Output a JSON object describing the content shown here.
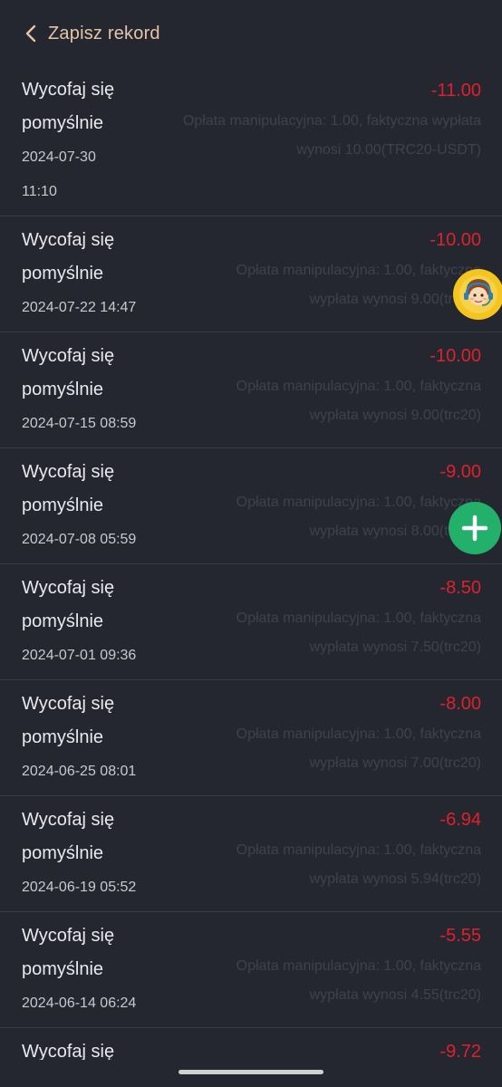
{
  "header": {
    "title": "Zapisz rekord"
  },
  "records": [
    {
      "title_line1": "Wycofaj się",
      "title_line2": "pomyślnie",
      "date": "2024-07-30",
      "time": "11:10",
      "amount": "-11.00",
      "fee_line1": "Opłata manipulacyjna: 1.00, faktyczna wypłata",
      "fee_line2": "wynosi 10.00(TRC20-USDT)"
    },
    {
      "title_line1": "Wycofaj się",
      "title_line2": "pomyślnie",
      "date": "2024-07-22 14:47",
      "amount": "-10.00",
      "fee_line1": "Opłata manipulacyjna: 1.00, faktyczna",
      "fee_line2": "wypłata wynosi 9.00(trc20)"
    },
    {
      "title_line1": "Wycofaj się",
      "title_line2": "pomyślnie",
      "date": "2024-07-15 08:59",
      "amount": "-10.00",
      "fee_line1": "Opłata manipulacyjna: 1.00, faktyczna",
      "fee_line2": "wypłata wynosi 9.00(trc20)"
    },
    {
      "title_line1": "Wycofaj się",
      "title_line2": "pomyślnie",
      "date": "2024-07-08 05:59",
      "amount": "-9.00",
      "fee_line1": "Opłata manipulacyjna: 1.00, faktyczna",
      "fee_line2": "wypłata wynosi 8.00(trc20)"
    },
    {
      "title_line1": "Wycofaj się",
      "title_line2": "pomyślnie",
      "date": "2024-07-01 09:36",
      "amount": "-8.50",
      "fee_line1": "Opłata manipulacyjna: 1.00, faktyczna",
      "fee_line2": "wypłata wynosi 7.50(trc20)"
    },
    {
      "title_line1": "Wycofaj się",
      "title_line2": "pomyślnie",
      "date": "2024-06-25 08:01",
      "amount": "-8.00",
      "fee_line1": "Opłata manipulacyjna: 1.00, faktyczna",
      "fee_line2": "wypłata wynosi 7.00(trc20)"
    },
    {
      "title_line1": "Wycofaj się",
      "title_line2": "pomyślnie",
      "date": "2024-06-19 05:52",
      "amount": "-6.94",
      "fee_line1": "Opłata manipulacyjna: 1.00, faktyczna",
      "fee_line2": "wypłata wynosi 5.94(trc20)"
    },
    {
      "title_line1": "Wycofaj się",
      "title_line2": "pomyślnie",
      "date": "2024-06-14 06:24",
      "amount": "-5.55",
      "fee_line1": "Opłata manipulacyjna: 1.00, faktyczna",
      "fee_line2": "wypłata wynosi 4.55(trc20)"
    },
    {
      "title_line1": "Wycofaj się",
      "amount": "-9.72"
    }
  ],
  "icons": {
    "back": "chevron-left-icon",
    "support": "customer-support-avatar-icon",
    "add": "plus-icon"
  },
  "colors": {
    "accent": "#e7c4a6",
    "negative": "#e0202a",
    "background": "#24272f",
    "add_button": "#23b06b",
    "support_button": "#f4c51e"
  }
}
